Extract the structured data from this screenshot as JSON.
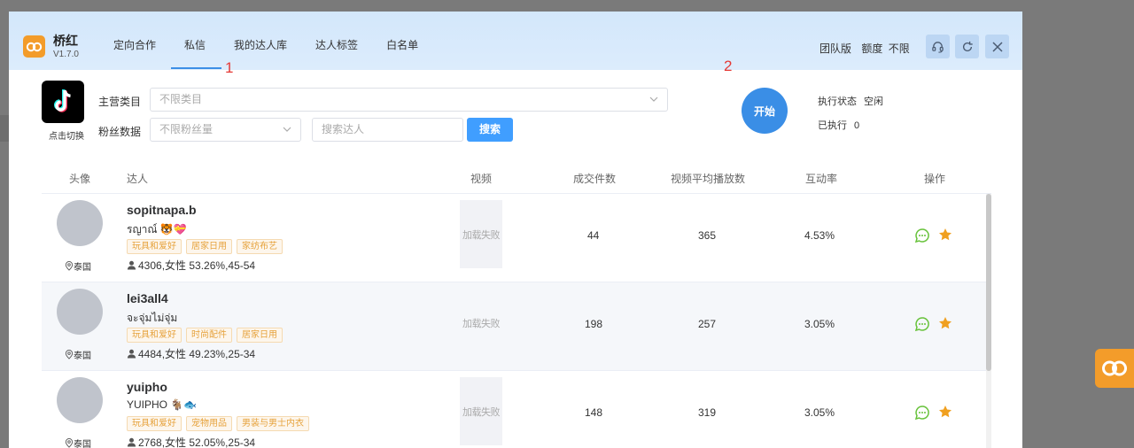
{
  "app": {
    "name": "桥红",
    "version": "V1.7.0"
  },
  "nav": {
    "tabs": [
      "定向合作",
      "私信",
      "我的达人库",
      "达人标签",
      "白名单"
    ],
    "active_index": 1
  },
  "header_right": {
    "edition": "团队版",
    "quota_label": "额度",
    "quota_value": "不限"
  },
  "platform": {
    "switch_label": "点击切换"
  },
  "filters": {
    "category_label": "主营类目",
    "category_placeholder": "不限类目",
    "fans_label": "粉丝数据",
    "fans_placeholder": "不限粉丝量",
    "search_placeholder": "搜索达人",
    "search_button": "搜索"
  },
  "control": {
    "start_button": "开始",
    "status_label": "执行状态",
    "status_value": "空闲",
    "executed_label": "已执行",
    "executed_value": "0"
  },
  "annotations": [
    "1",
    "2"
  ],
  "table": {
    "headers": [
      "头像",
      "达人",
      "视频",
      "成交件数",
      "视频平均播放数",
      "互动率",
      "操作"
    ],
    "rows": [
      {
        "username": "sopitnapa.b",
        "nickname": "รญาณ์ 🐯💝",
        "tags": [
          "玩具和爱好",
          "居家日用",
          "家纺布艺"
        ],
        "fans": "4306,女性 53.26%,45-54",
        "location": "泰国",
        "video": "加载失败",
        "sales": "44",
        "avg_views": "365",
        "engagement": "4.53%"
      },
      {
        "username": "lei3all4",
        "nickname": "จะจุ่มไม่จุ่ม",
        "tags": [
          "玩具和爱好",
          "时尚配件",
          "居家日用"
        ],
        "fans": "4484,女性 49.23%,25-34",
        "location": "泰国",
        "video": "加载失败",
        "sales": "198",
        "avg_views": "257",
        "engagement": "3.05%"
      },
      {
        "username": "yuipho",
        "nickname": "YUIPHO 🐐🐟",
        "tags": [
          "玩具和爱好",
          "宠物用品",
          "男装与男士内衣"
        ],
        "fans": "2768,女性 52.05%,25-34",
        "location": "泰国",
        "video": "加载失败",
        "sales": "148",
        "avg_views": "319",
        "engagement": "3.05%"
      }
    ]
  },
  "colors": {
    "accent": "#409eff",
    "brand": "#f39c2a",
    "tag_text": "#e6a23c",
    "chat": "#67c23a",
    "star": "#f0a020"
  }
}
